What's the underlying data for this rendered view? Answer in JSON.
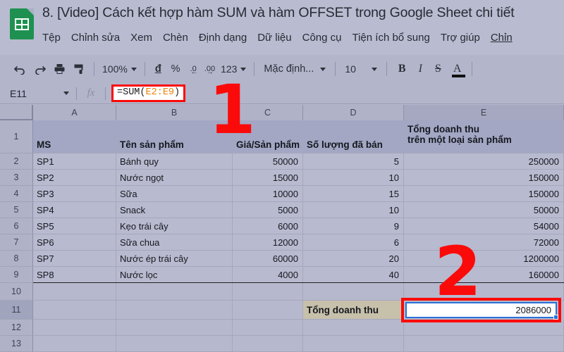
{
  "window": {
    "doc_title": "8. [Video] Cách kết hợp hàm SUM và hàm OFFSET trong Google Sheet chi tiết",
    "logo_icon": "google-sheets-logo"
  },
  "menubar": {
    "items": [
      {
        "label": "Tệp"
      },
      {
        "label": "Chỉnh sửa"
      },
      {
        "label": "Xem"
      },
      {
        "label": "Chèn"
      },
      {
        "label": "Định dạng"
      },
      {
        "label": "Dữ liệu"
      },
      {
        "label": "Công cụ"
      },
      {
        "label": "Tiện ích bổ sung"
      },
      {
        "label": "Trợ giúp"
      },
      {
        "label": "Chỉn"
      }
    ]
  },
  "toolbar": {
    "undo_icon": "undo-icon",
    "redo_icon": "redo-icon",
    "print_icon": "print-icon",
    "paint_format_icon": "paint-format-icon",
    "zoom_value": "100%",
    "currency_label": "đ",
    "percent_label": "%",
    "dec_decrease_label": ".0",
    "dec_increase_label": ".00",
    "number_format_label": "123",
    "font_label": "Mặc định...",
    "font_size": "10",
    "bold_label": "B",
    "italic_label": "I",
    "strike_label": "S",
    "text_color_label": "A"
  },
  "formula_bar": {
    "name_box": "E11",
    "fx_label": "fx",
    "formula_prefix": "=SUM(",
    "formula_range": "E2:E9",
    "formula_suffix": ")"
  },
  "sheet": {
    "columns": [
      {
        "label": "A",
        "selected": false
      },
      {
        "label": "B",
        "selected": false
      },
      {
        "label": "C",
        "selected": false
      },
      {
        "label": "D",
        "selected": false
      },
      {
        "label": "E",
        "selected": true
      }
    ],
    "rows": [
      "1",
      "2",
      "3",
      "4",
      "5",
      "6",
      "7",
      "8",
      "9",
      "10",
      "11",
      "12",
      "13"
    ],
    "selected_row": "11",
    "headers": [
      "MS",
      "Tên sản phẩm",
      "Giá/Sản phẩm",
      "Số lượng đã bán",
      "Tổng doanh thu\ntrên một loại sản phẩm"
    ],
    "header_e_line1": "Tổng doanh thu",
    "header_e_line2": "trên một loại sản phẩm",
    "data_rows": [
      {
        "ms": "SP1",
        "name": "Bánh quy",
        "price": "50000",
        "qty": "5",
        "revenue": "250000"
      },
      {
        "ms": "SP2",
        "name": "Nước ngọt",
        "price": "15000",
        "qty": "10",
        "revenue": "150000"
      },
      {
        "ms": "SP3",
        "name": "Sữa",
        "price": "10000",
        "qty": "15",
        "revenue": "150000"
      },
      {
        "ms": "SP4",
        "name": "Snack",
        "price": "5000",
        "qty": "10",
        "revenue": "50000"
      },
      {
        "ms": "SP5",
        "name": "Kẹo trái cây",
        "price": "6000",
        "qty": "9",
        "revenue": "54000"
      },
      {
        "ms": "SP6",
        "name": "Sữa chua",
        "price": "12000",
        "qty": "6",
        "revenue": "72000"
      },
      {
        "ms": "SP7",
        "name": "Nước ép trái cây",
        "price": "60000",
        "qty": "20",
        "revenue": "1200000"
      },
      {
        "ms": "SP8",
        "name": "Nước lọc",
        "price": "4000",
        "qty": "40",
        "revenue": "160000"
      }
    ],
    "total_label": "Tổng doanh thu",
    "total_value": "2086000"
  },
  "annotations": [
    {
      "label": "1"
    },
    {
      "label": "2"
    }
  ],
  "colors": {
    "brand_green": "#1e9150",
    "annotation_red": "#fb0a0a",
    "selection_blue": "#2a72d8",
    "formula_range_orange": "#e8820c",
    "header_fill": "#a3a7c4",
    "total_label_fill": "#c7c0ab"
  }
}
